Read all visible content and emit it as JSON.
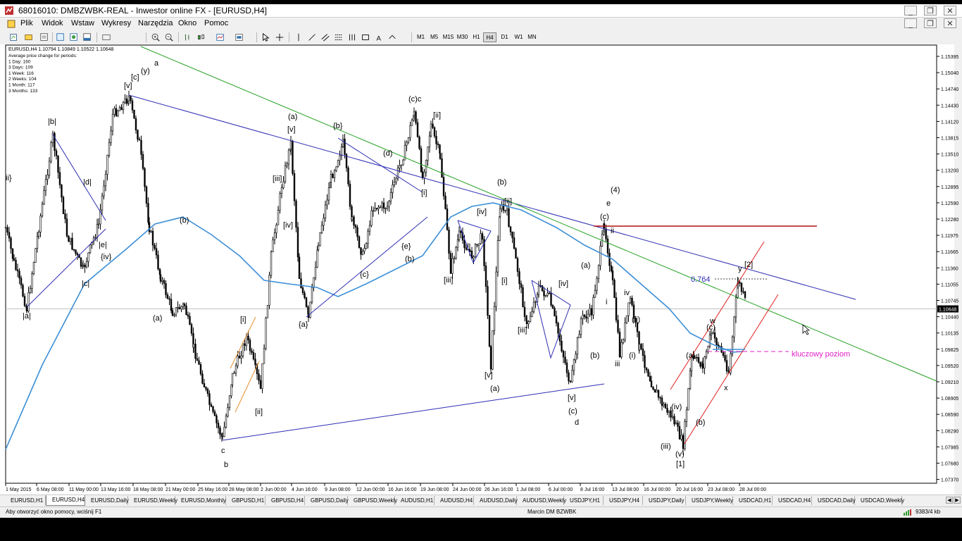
{
  "window": {
    "title": "68016010: DMBZWBK-REAL - Inwestor online FX - [EURUSD,H4]",
    "controls": [
      "_",
      "❐",
      "✕"
    ]
  },
  "menu": [
    "Plik",
    "Widok",
    "Wstaw",
    "Wykresy",
    "Narzędzia",
    "Okno",
    "Pomoc"
  ],
  "timeframes": [
    "M1",
    "M5",
    "M15",
    "M30",
    "H1",
    "H4",
    "D1",
    "W1",
    "MN"
  ],
  "active_timeframe": "H4",
  "info_panel": {
    "header": "EURUSD,H4  1.10794 1.10849 1.10522 1.10648",
    "lines": [
      "Average price change for periods:",
      "1 Day: 160",
      "3 Days: 109",
      "1 Week: 116",
      "2 Weeks: 104",
      "1 Month: 117",
      "3 Months: 133"
    ]
  },
  "price_axis": [
    "1.15395",
    "1.15040",
    "1.14740",
    "1.14430",
    "1.14120",
    "1.13815",
    "1.13510",
    "1.13200",
    "1.12895",
    "1.12590",
    "1.12280",
    "1.11975",
    "1.11665",
    "1.11360",
    "1.11055",
    "1.10745",
    "1.10440",
    "1.10135",
    "1.09825",
    "1.09520",
    "1.09210",
    "1.08905",
    "1.08590",
    "1.08290",
    "1.07985",
    "1.07680",
    "1.07370"
  ],
  "current_price": "1.10648",
  "time_axis": [
    "1 May 2015",
    "6 May 08:00",
    "11 May 00:00",
    "13 May 16:00",
    "18 May 08:00",
    "21 May 00:00",
    "25 May 16:00",
    "28 May 08:00",
    "2 Jun 00:00",
    "4 Jun 16:00",
    "9 Jun 08:00",
    "12 Jun 00:00",
    "16 Jun 16:00",
    "19 Jun 08:00",
    "24 Jun 00:00",
    "26 Jun 16:00",
    "1 Jul 08:00",
    "6 Jul 00:00",
    "8 Jul 16:00",
    "13 Jul 08:00",
    "16 Jul 00:00",
    "20 Jul 16:00",
    "23 Jul 08:00",
    "28 Jul 00:00"
  ],
  "annotations": {
    "fib_level": "0.764",
    "key_level": "kluczowy poziom",
    "wave_labels": [
      "a",
      "[c]",
      "(y)",
      "[v]",
      "|b|",
      "|d|",
      "|e|",
      "{iv}",
      "|c|",
      "|a|",
      "ii}",
      "(b)",
      "(a)",
      "c",
      "b",
      "[i]",
      "[ii]",
      "(a)",
      "[v]",
      "[iii]",
      "[iv]",
      "{a}",
      "{b}",
      "(d)",
      "{c}",
      "{e}",
      "(b)",
      "(c)c",
      "[ii]",
      "[i]",
      "[iv]",
      "[iii]",
      "[v]",
      "(a)",
      "(b)",
      "[ii]",
      "[i]",
      "[iii]",
      "[iv]",
      "[v]",
      "(c)",
      "d",
      "(4)",
      "e",
      "(c)",
      "ii",
      "(a)",
      "i",
      "iv",
      "(b)",
      "iii",
      "(ii)",
      "(i)",
      "(iv)",
      "(iii)",
      "(v)",
      "[1]",
      "(a)",
      "(b)",
      "w",
      "(c)",
      "y",
      "[2]",
      "x"
    ]
  },
  "symbol_tabs": [
    "EURUSD,H1",
    "EURUSD,H4",
    "EURUSD,Daily",
    "EURUSD,Weekly",
    "EURUSD,Monthly",
    "GBPUSD,H1",
    "GBPUSD,H4",
    "GBPUSD,Daily",
    "GBPUSD,Weekly",
    "AUDUSD,H1",
    "AUDUSD,H4",
    "AUDUSD,Daily",
    "AUDUSD,Weekly",
    "USDJPY,H1",
    "USDJPY,H4",
    "USDJPY,Daily",
    "USDJPY,Weekly",
    "USDCAD,H1",
    "USDCAD,H4",
    "USDCAD,Daily",
    "USDCAD,Weekly"
  ],
  "active_tab": "EURUSD,H4",
  "status": {
    "help": "Aby otworzyć okno pomocy, wciśnij F1",
    "profile": "Marcin DM BZWBK",
    "traffic": "9383/4 kb"
  },
  "colors": {
    "candles": "#000000",
    "moving_average": "#3c8fd6",
    "trendline_blue": "#2d2db4",
    "trendline_green": "#22a022",
    "channel_red": "#e02020",
    "resistance_red": "#b01010",
    "key_level_magenta": "#e020c8",
    "triangle_orange": "#e89030"
  }
}
